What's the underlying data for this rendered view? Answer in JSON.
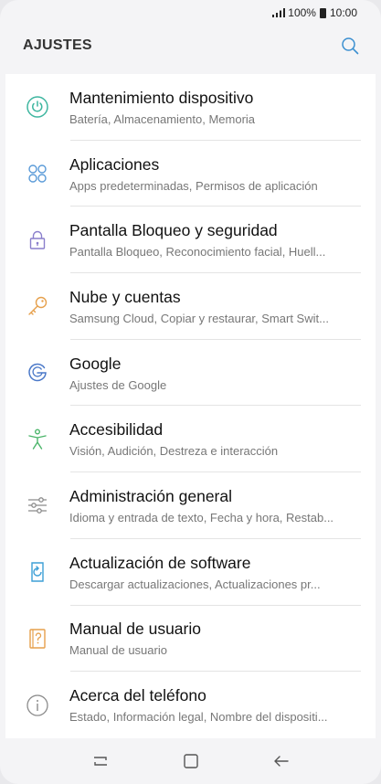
{
  "status": {
    "battery": "100%",
    "time": "10:00"
  },
  "header": {
    "title": "AJUSTES",
    "search_icon": "search-icon"
  },
  "settings": [
    {
      "icon": "maintenance-icon",
      "color": "#3fb6a0",
      "title": "Mantenimiento dispositivo",
      "subtitle": "Batería, Almacenamiento, Memoria"
    },
    {
      "icon": "apps-icon",
      "color": "#5b9bd8",
      "title": "Aplicaciones",
      "subtitle": "Apps predeterminadas, Permisos de aplicación"
    },
    {
      "icon": "lock-icon",
      "color": "#8a7fcc",
      "title": "Pantalla Bloqueo y seguridad",
      "subtitle": "Pantalla Bloqueo, Reconocimiento facial, Huell..."
    },
    {
      "icon": "key-icon",
      "color": "#e6a04c",
      "title": "Nube y cuentas",
      "subtitle": "Samsung Cloud, Copiar y restaurar, Smart Swit..."
    },
    {
      "icon": "google-icon",
      "color": "#4a78c8",
      "title": "Google",
      "subtitle": "Ajustes de Google"
    },
    {
      "icon": "accessibility-icon",
      "color": "#4bb56a",
      "title": "Accesibilidad",
      "subtitle": "Visión, Audición, Destreza e interacción"
    },
    {
      "icon": "sliders-icon",
      "color": "#8b8b8b",
      "title": "Administración general",
      "subtitle": "Idioma y entrada de texto, Fecha y hora, Restab..."
    },
    {
      "icon": "software-update-icon",
      "color": "#3d9fd6",
      "title": "Actualización de software",
      "subtitle": "Descargar actualizaciones, Actualizaciones pr..."
    },
    {
      "icon": "manual-icon",
      "color": "#e6a04c",
      "title": "Manual de usuario",
      "subtitle": "Manual de usuario"
    },
    {
      "icon": "info-icon",
      "color": "#8b8b8b",
      "title": "Acerca del teléfono",
      "subtitle": "Estado, Información legal, Nombre del dispositi..."
    }
  ],
  "nav": [
    "recent-apps-icon",
    "home-icon",
    "back-icon"
  ]
}
